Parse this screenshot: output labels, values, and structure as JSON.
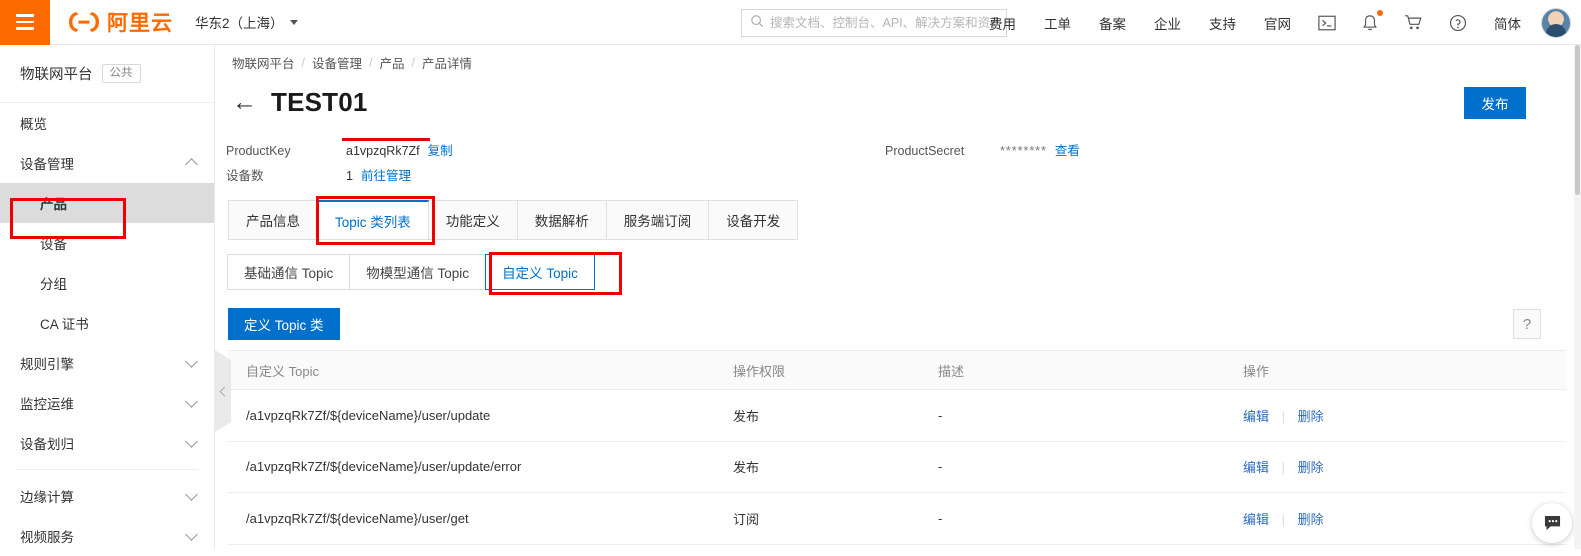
{
  "topbar": {
    "menu_icon": "hamburger-icon",
    "logo_text": "阿里云",
    "region": "华东2（上海）",
    "search_placeholder": "搜索文档、控制台、API、解决方案和资源",
    "nav_items": [
      {
        "label": "费用"
      },
      {
        "label": "工单"
      },
      {
        "label": "备案"
      },
      {
        "label": "企业"
      },
      {
        "label": "支持"
      },
      {
        "label": "官网"
      }
    ],
    "icons": [
      {
        "name": "terminal-icon"
      },
      {
        "name": "bell-icon"
      },
      {
        "name": "cart-icon"
      },
      {
        "name": "help-circle-icon"
      }
    ],
    "language": "简体",
    "avatar": "user-avatar"
  },
  "sidebar": {
    "title": "物联网平台",
    "tag": "公共",
    "items": [
      {
        "label": "概览",
        "level": 1,
        "expandable": false,
        "active": false
      },
      {
        "label": "设备管理",
        "level": 1,
        "expandable": true,
        "expanded": true,
        "active": false
      },
      {
        "label": "产品",
        "level": 2,
        "expandable": false,
        "active": true
      },
      {
        "label": "设备",
        "level": 2,
        "expandable": false,
        "active": false
      },
      {
        "label": "分组",
        "level": 2,
        "expandable": false,
        "active": false
      },
      {
        "label": "CA 证书",
        "level": 2,
        "expandable": false,
        "active": false
      },
      {
        "label": "规则引擎",
        "level": 1,
        "expandable": true,
        "expanded": false,
        "active": false
      },
      {
        "label": "监控运维",
        "level": 1,
        "expandable": true,
        "expanded": false,
        "active": false
      },
      {
        "label": "设备划归",
        "level": 1,
        "expandable": true,
        "expanded": false,
        "active": false
      },
      {
        "label": "边缘计算",
        "level": 1,
        "expandable": true,
        "expanded": false,
        "active": false
      },
      {
        "label": "视频服务",
        "level": 1,
        "expandable": true,
        "expanded": false,
        "active": false
      }
    ],
    "collapse_handle": "chevron-left-icon"
  },
  "main": {
    "breadcrumb": [
      "物联网平台",
      "设备管理",
      "产品",
      "产品详情"
    ],
    "back_arrow": "←",
    "page_title": "TEST01",
    "publish_button": "发布",
    "meta": {
      "product_key_label": "ProductKey",
      "product_key_value": "a1vpzqRk7Zf",
      "product_key_action": "复制",
      "device_count_label": "设备数",
      "device_count_value": "1",
      "device_count_action": "前往管理",
      "product_secret_label": "ProductSecret",
      "product_secret_value": "********",
      "product_secret_action": "查看"
    },
    "tabs": [
      {
        "label": "产品信息",
        "active": false
      },
      {
        "label": "Topic 类列表",
        "active": true
      },
      {
        "label": "功能定义",
        "active": false
      },
      {
        "label": "数据解析",
        "active": false
      },
      {
        "label": "服务端订阅",
        "active": false
      },
      {
        "label": "设备开发",
        "active": false
      }
    ],
    "subtabs": [
      {
        "label": "基础通信 Topic",
        "active": false
      },
      {
        "label": "物模型通信 Topic",
        "active": false
      },
      {
        "label": "自定义 Topic",
        "active": true
      }
    ],
    "define_button": "定义 Topic 类",
    "help_button": "?",
    "table": {
      "columns": [
        "自定义 Topic",
        "操作权限",
        "描述",
        "操作"
      ],
      "rows": [
        {
          "topic": "/a1vpzqRk7Zf/${deviceName}/user/update",
          "permission": "发布",
          "description": "-",
          "actions": [
            "编辑",
            "删除"
          ]
        },
        {
          "topic": "/a1vpzqRk7Zf/${deviceName}/user/update/error",
          "permission": "发布",
          "description": "-",
          "actions": [
            "编辑",
            "删除"
          ]
        },
        {
          "topic": "/a1vpzqRk7Zf/${deviceName}/user/get",
          "permission": "订阅",
          "description": "-",
          "actions": [
            "编辑",
            "删除"
          ]
        }
      ]
    },
    "chat_fab": "chat-bubble-icon"
  },
  "annotations": {
    "highlight_color": "#ee0000",
    "boxes": [
      "sidebar-product-item",
      "topic-list-tab",
      "custom-topic-subtab"
    ],
    "underline": "device-count-link"
  },
  "colors": {
    "brand_orange": "#ff6a00",
    "primary_blue": "#0070cc",
    "link_blue": "#2d6cc0",
    "annotation_red": "#ee0000"
  }
}
